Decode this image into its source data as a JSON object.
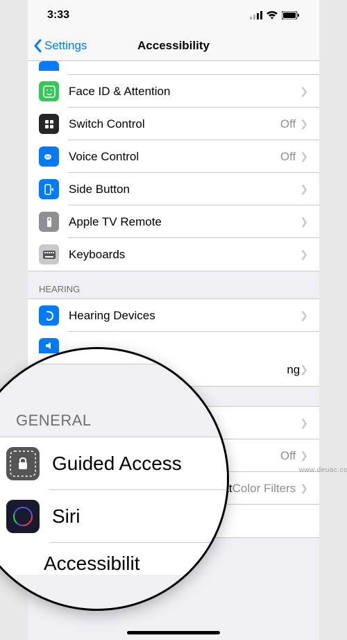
{
  "statusbar": {
    "time": "3:33"
  },
  "nav": {
    "back": "Settings",
    "title": "Accessibility"
  },
  "rows": [
    {
      "icon": "face-id-icon",
      "label": "Face ID & Attention",
      "value": "",
      "color": "ic-green"
    },
    {
      "icon": "switch-control-icon",
      "label": "Switch Control",
      "value": "Off",
      "color": "ic-dark"
    },
    {
      "icon": "voice-control-icon",
      "label": "Voice Control",
      "value": "Off",
      "color": "ic-blue"
    },
    {
      "icon": "side-button-icon",
      "label": "Side Button",
      "value": "",
      "color": "ic-blue"
    },
    {
      "icon": "apple-tv-icon",
      "label": "Apple TV Remote",
      "value": "",
      "color": "ic-gray"
    },
    {
      "icon": "keyboard-icon",
      "label": "Keyboards",
      "value": "",
      "color": "ic-lightgray"
    }
  ],
  "sections": {
    "hearing": "HEARING",
    "general": "GENERAL"
  },
  "hearing_rows": [
    {
      "icon": "hearing-icon",
      "label": "Hearing Devices",
      "value": "",
      "color": "ic-blue"
    },
    {
      "icon": "audio-icon",
      "label": "",
      "value": "",
      "color": "ic-blue",
      "partial": true
    }
  ],
  "obscured_rows": [
    {
      "suffix": "ng",
      "value": ""
    },
    {
      "label": "",
      "value": ""
    },
    {
      "label": "",
      "value": "Off"
    },
    {
      "suffix": "at",
      "value": "Color Filters"
    }
  ],
  "general_rows": [
    {
      "icon": "guided-access-icon",
      "label": "Guided Access",
      "value": "Off"
    },
    {
      "icon": "siri-icon",
      "label": "Siri",
      "value": ""
    },
    {
      "icon": "shortcut-icon",
      "label_partial": "Accessibilit"
    }
  ],
  "watermark": "www.deuac.com"
}
